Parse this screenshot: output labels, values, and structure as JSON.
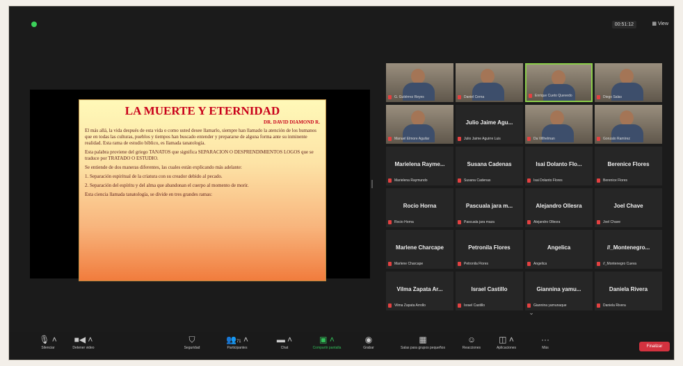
{
  "meeting": {
    "timer": "00:51:12",
    "view_label": "View"
  },
  "slide": {
    "title": "LA MUERTE Y ETERNIDAD",
    "author": "DR. DAVID DIAMOND R.",
    "p1": "El más allá, la vida después de esta vida o como usted desee llamarlo, siempre han llamado la atención de los humanos que en todas las culturas, pueblos y tiempos han buscado entender y prepararse de alguna forma ante su inminente realidad. Esta rama de estudio bíblico, es llamada tanatología.",
    "p2": "Esta palabra proviene del griego TANATOS que significa SEPARACION O DESPRENDIMIENTOS LOGOS que se traduce por TRATADO O ESTUDIO.",
    "p3": "Se entiende de dos maneras diferentes, las cuales están explicando más adelante:",
    "li1": "1.   Separación espiritual de la criatura con su creador debido al pecado.",
    "li2": "2.   Separación del espíritu y del alma que abandonan el cuerpo al momento de morir.",
    "p4": "Esta ciencia llamada tanatología, se divide en tres grandes ramas:"
  },
  "participants": [
    {
      "big": "",
      "small": "G. Gutiérrez Reyes",
      "video": true
    },
    {
      "big": "",
      "small": "Daniel Cerna",
      "video": true
    },
    {
      "big": "",
      "small": "Enrique Cueto Quevedo",
      "video": true,
      "active": true
    },
    {
      "big": "",
      "small": "Diego Salas",
      "video": true
    },
    {
      "big": "",
      "small": "Manuel Elmore Aguilar",
      "video": true
    },
    {
      "big": "Julio Jaime Agu...",
      "small": "Julio Jaime Aguirre Luis",
      "video": false
    },
    {
      "big": "",
      "small": "Da Villhelman",
      "video": true
    },
    {
      "big": "",
      "small": "Gonzalo Ramírez",
      "video": true
    },
    {
      "big": "Marielena Rayme...",
      "small": "Marielena Raymundo",
      "video": false
    },
    {
      "big": "Susana Cadenas",
      "small": "Susana Cadenas",
      "video": false
    },
    {
      "big": "Isai Dolanto Flo...",
      "small": "Isai Dolanto Flores",
      "video": false
    },
    {
      "big": "Berenice Flores",
      "small": "Berenice Flores",
      "video": false
    },
    {
      "big": "Rocio Horna",
      "small": "Rocio Horna",
      "video": false
    },
    {
      "big": "Pascuala jara m...",
      "small": "Pascuala jara maza",
      "video": false
    },
    {
      "big": "Alejandro Ollesra",
      "small": "Alejandro Ollesra",
      "video": false
    },
    {
      "big": "Joel Chave",
      "small": "Joel Chave",
      "video": false
    },
    {
      "big": "Marlene Charcape",
      "small": "Marlene Charcape",
      "video": false
    },
    {
      "big": "Petronila Flores",
      "small": "Petronila Flores",
      "video": false
    },
    {
      "big": "Angelica",
      "small": "Angelica",
      "video": false
    },
    {
      "big": "//_Montenegro...",
      "small": "//_Montenegro Cueva",
      "video": false
    },
    {
      "big": "Vilma Zapata Ar...",
      "small": "Vilma Zapata Arrollo",
      "video": false
    },
    {
      "big": "Israel Castillo",
      "small": "Israel Castillo",
      "video": false
    },
    {
      "big": "Giannina yamu...",
      "small": "Giannina yamunaque",
      "video": false
    },
    {
      "big": "Daniela Rivera",
      "small": "Daniela Rivera",
      "video": false
    }
  ],
  "toolbar": {
    "mute": "Silenciar",
    "video": "Detener video",
    "security": "Seguridad",
    "participants": "Participantes",
    "participants_count": "71",
    "chat": "Chat",
    "share": "Compartir pantalla",
    "record": "Grabar",
    "breakout": "Salas para grupos pequeños",
    "reactions": "Reacciones",
    "apps": "Aplicaciones",
    "more": "Más",
    "end": "Finalizar"
  }
}
